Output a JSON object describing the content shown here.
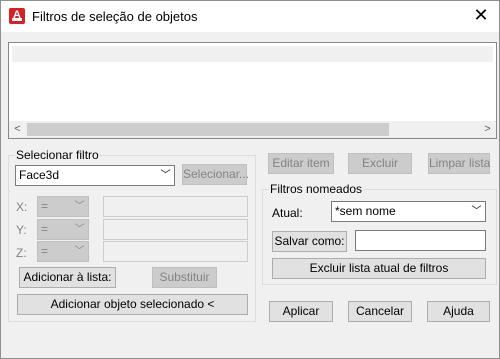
{
  "window": {
    "title": "Filtros de seleção de objetos",
    "app_icon_letter": "A",
    "close_glyph": "✕"
  },
  "selecionar_filtro": {
    "group_label": "Selecionar filtro",
    "type_value": "Face3d",
    "select_button": "Selecionar...",
    "x_label": "X:",
    "y_label": "Y:",
    "z_label": "Z:",
    "operator": "=",
    "add_to_list_button": "Adicionar à lista:",
    "replace_button": "Substituir",
    "add_selected_button": "Adicionar objeto selecionado <"
  },
  "list_actions": {
    "edit_item": "Editar item",
    "delete": "Excluir",
    "clear_list": "Limpar lista"
  },
  "filtros_nomeados": {
    "group_label": "Filtros nomeados",
    "current_label": "Atual:",
    "current_value": "*sem nome",
    "save_as_button": "Salvar como:",
    "save_as_value": "",
    "delete_current_button": "Excluir lista atual de filtros"
  },
  "footer": {
    "apply": "Aplicar",
    "cancel": "Cancelar",
    "help": "Ajuda"
  },
  "icons": {
    "chevron": "﹀",
    "scroll_left": "<",
    "scroll_right": ">"
  }
}
